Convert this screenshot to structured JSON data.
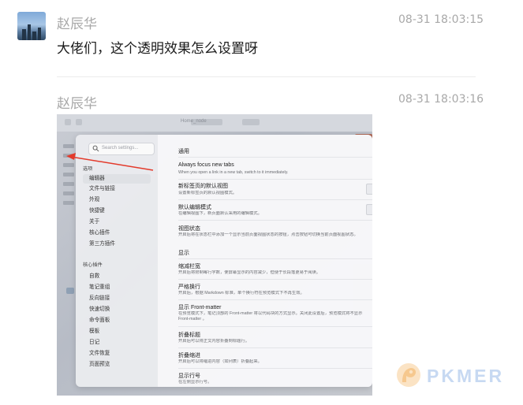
{
  "messages": [
    {
      "sender": "赵辰华",
      "time": "08-31 18:03:15",
      "text": "大佬们，这个透明效果怎么设置呀"
    },
    {
      "sender": "赵辰华",
      "time": "08-31 18:03:16"
    }
  ],
  "screenshot": {
    "tab_title": "Home_node",
    "search_placeholder": "Search settings...",
    "sidebar": {
      "section_options": "选项",
      "options": [
        "编辑器",
        "文件与链接",
        "外观",
        "快捷键",
        "关于",
        "核心插件",
        "第三方插件"
      ],
      "active_index": 0,
      "section_core": "核心插件",
      "core_plugins": [
        "自救",
        "笔记重组",
        "反向链接",
        "快速切换",
        "命令面板",
        "模板",
        "日记",
        "文件恢复",
        "页面预览"
      ]
    },
    "content": {
      "section_general": "通用",
      "section_display": "显示",
      "settings": [
        {
          "title": "Always focus new tabs",
          "desc": "When you open a link in a new tab, switch to it immediately."
        },
        {
          "title": "新标签页的默认视图",
          "desc": "设置新标签页的默认视图模式。"
        },
        {
          "title": "默认编辑模式",
          "desc": "在编辑视图下，新页面默认采用的编辑模式。"
        },
        {
          "title": "视图状态",
          "desc": "开启后将在状态栏中添加一个显示当前页面视图状态的按钮，点击按钮可切换当前页面视图状态。"
        },
        {
          "title": "缩减栏宽",
          "desc": "开启后将限制每行字数，使屏幕显示的内容减少，但便于长段落更易于阅读。"
        },
        {
          "title": "严格换行",
          "desc": "开启后，根据 Markdown 标准，单个换行符在预览模式下不再生效。"
        },
        {
          "title": "显示 Front-matter",
          "desc": "在预览模式下，笔记顶部的 Front-matter 将以代码块的方式显示。关闭此设置后，预览模式将不显示 Front-matter 。"
        },
        {
          "title": "折叠标题",
          "desc": "开启后可以将正文内容折叠到标题行。"
        },
        {
          "title": "折叠缩进",
          "desc": "开启后可以将缩进内容（如列表）折叠起来。"
        },
        {
          "title": "显示行号",
          "desc": "在左侧显示行号。"
        }
      ]
    }
  },
  "watermark": {
    "text": "PKMER"
  },
  "colors": {
    "meta_gray": "#a8a8a8",
    "arrow_red": "#e33a2b",
    "watermark_blue": "#c7d9f2",
    "watermark_orange": "#f6c88e"
  }
}
